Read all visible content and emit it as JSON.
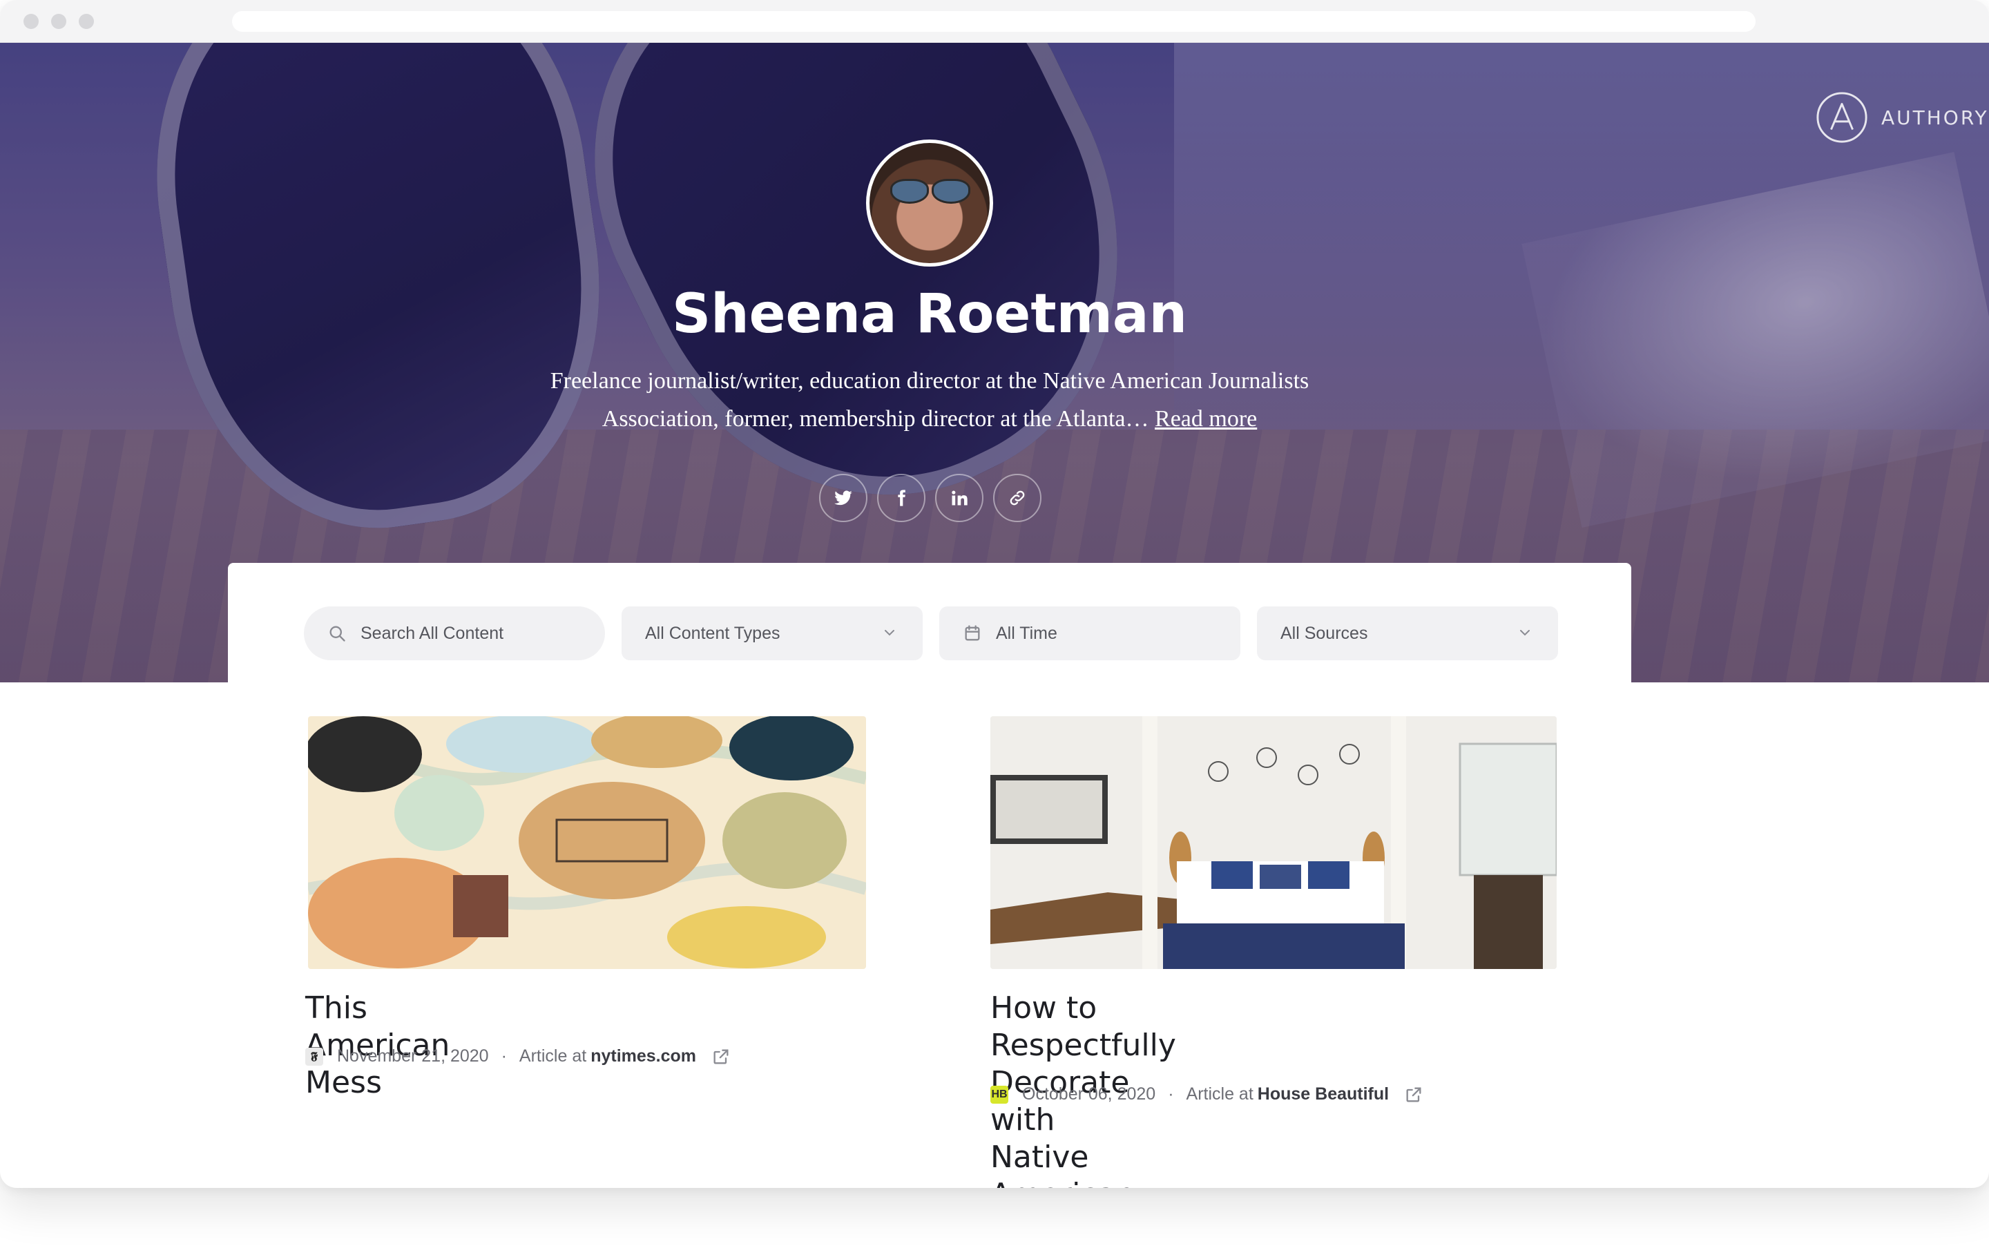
{
  "brand": {
    "name": "AUTHORY"
  },
  "profile": {
    "name": "Sheena Roetman",
    "bio_line1": "Freelance journalist/writer, education director at the Native American Journalists",
    "bio_line2": "Association, former, membership director at the Atlanta…",
    "read_more": "Read more",
    "socials": [
      "twitter-icon",
      "facebook-icon",
      "linkedin-icon",
      "link-icon"
    ]
  },
  "filters": {
    "search_placeholder": "Search All Content",
    "content_types": "All Content Types",
    "time": "All Time",
    "sources": "All Sources"
  },
  "articles": [
    {
      "title": "This American Mess",
      "date": "November 21, 2020",
      "type_prefix": "Article at",
      "source": "nytimes.com",
      "favicon": "𝕱"
    },
    {
      "title_line1": "How to Respectfully Decorate with",
      "title_line2": "Native American Decor",
      "date": "October 06, 2020",
      "type_prefix": "Article at",
      "source": "House Beautiful",
      "favicon": "HB"
    }
  ],
  "colors": {
    "hero_tint": "#52508f",
    "favicon_hb": "#d7e62b"
  }
}
